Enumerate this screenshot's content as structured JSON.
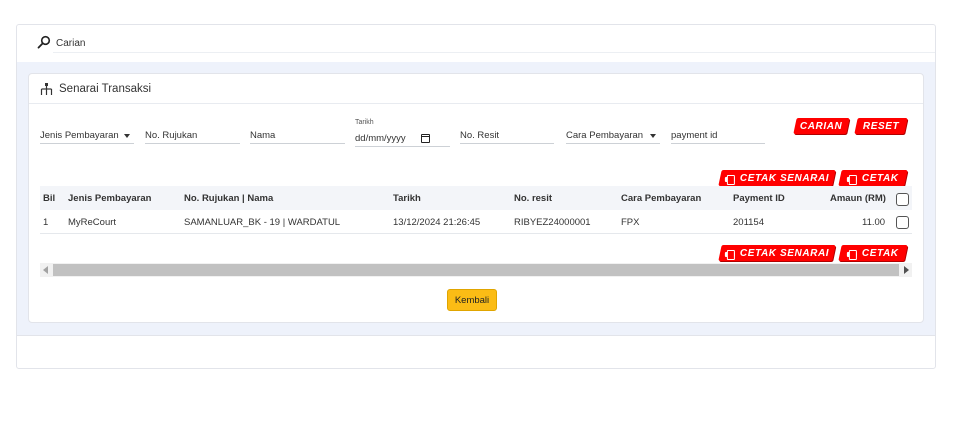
{
  "search": {
    "label": "Carian"
  },
  "panel": {
    "title": "Senarai Transaksi"
  },
  "filters": {
    "payment_type": "Jenis Pembayaran",
    "reference_no": "No. Rujukan",
    "name": "Nama",
    "date_label": "Tarikh",
    "date_value": "dd/mm/yyyy",
    "receipt_no": "No. Resit",
    "payment_method": "Cara Pembayaran",
    "payment_id": "payment id"
  },
  "actions": {
    "search_label": "CARIAN",
    "reset_label": "RESET",
    "print_list_label": "CETAK SENARAI",
    "print_label": "CETAK",
    "back_label": "Kembali"
  },
  "table": {
    "headers": [
      "Bil",
      "Jenis Pembayaran",
      "No. Rujukan | Nama",
      "Tarikh",
      "No. resit",
      "Cara Pembayaran",
      "Payment ID",
      "Amaun (RM)"
    ],
    "rows": [
      [
        "1",
        "MyReCourt",
        "SAMANLUAR_BK - 19 | WARDATUL",
        "13/12/2024 21:26:45",
        "RIBYEZ24000001",
        "FPX",
        "201154",
        "11.00"
      ]
    ]
  },
  "colors": {
    "danger": "#ff0000",
    "warning": "#fbbc15",
    "band": "#eef2fb"
  },
  "icons": {
    "search": "search-icon",
    "panel": "hierarchy-icon",
    "print": "print-icon",
    "calendar": "calendar-icon"
  }
}
